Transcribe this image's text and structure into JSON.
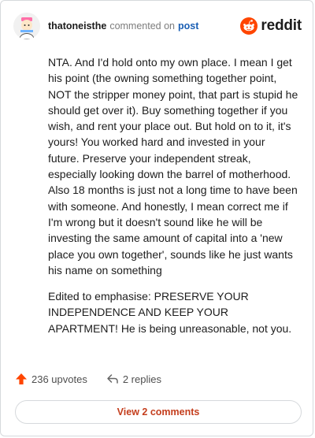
{
  "header": {
    "username": "thatoneisthe",
    "action": "commented on",
    "post_link": "post",
    "brand": "reddit"
  },
  "comment": {
    "paragraphs": [
      "NTA. And I'd hold onto my own place. I mean I get his point (the owning something together point, NOT the stripper money point, that part is stupid he should get over it). Buy something together if you wish, and rent your place out. But hold on to it, it's yours! You worked hard and invested in your future. Preserve your independent streak, especially looking down the barrel of motherhood. Also 18 months is just not a long time to have been with someone. And honestly, I mean correct me if I'm wrong but it doesn't sound like he will be investing the same amount of capital into a 'new place you own together', sounds like he just wants his name on something",
      "Edited to emphasise: PRESERVE YOUR INDEPENDENCE AND KEEP YOUR APARTMENT! He is being unreasonable, not you."
    ]
  },
  "actions": {
    "upvotes": "236 upvotes",
    "replies": "2 replies"
  },
  "view_button": "View 2 comments",
  "icons": {
    "upvote": "upvote-arrow-icon",
    "reply": "reply-arrow-icon",
    "brand": "reddit-logo-icon",
    "avatar": "user-avatar"
  },
  "colors": {
    "upvote": "#ff4500",
    "link": "#1a5fb4",
    "button_text": "#c43e1d",
    "brand": "#ff4500"
  }
}
